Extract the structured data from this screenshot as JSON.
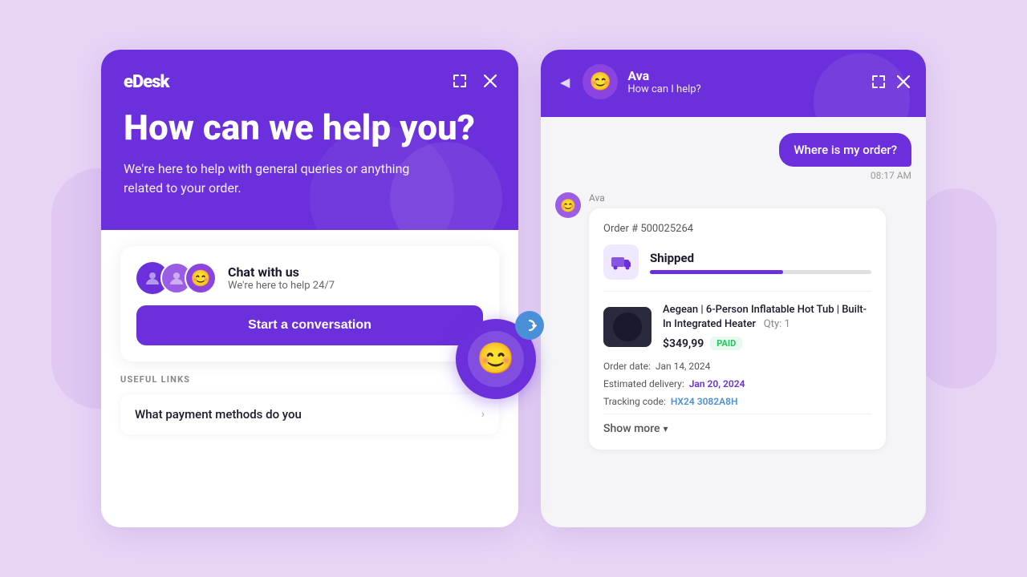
{
  "background": {
    "color": "#e8d5f5"
  },
  "left_panel": {
    "logo": "eDesk",
    "header": {
      "headline": "How can we help you?",
      "subtitle": "We're here to help with general queries or anything related to your order.",
      "expand_icon": "⤢",
      "close_icon": "✕"
    },
    "chat_card": {
      "title": "Chat with us",
      "subtitle": "We're here to help 24/7",
      "start_button": "Start a conversation"
    },
    "useful_links": {
      "label": "USEFUL LINKS",
      "items": [
        {
          "text": "What payment methods do you"
        }
      ]
    }
  },
  "right_panel": {
    "header": {
      "back_icon": "◀",
      "agent_name": "Ava",
      "agent_question": "How can I help?",
      "expand_icon": "⤢",
      "close_icon": "✕"
    },
    "messages": [
      {
        "type": "user",
        "text": "Where is my order?",
        "time": "08:17 AM"
      },
      {
        "type": "bot",
        "sender": "Ava",
        "order": {
          "number": "Order # 500025264",
          "status": "Shipped",
          "progress_percent": 60,
          "product_name": "Aegean | 6-Person Inflatable Hot Tub | Built-In Integrated Heater",
          "quantity": "Qty: 1",
          "price": "$349,99",
          "payment_status": "PAID",
          "order_date_label": "Order date:",
          "order_date": "Jan 14, 2024",
          "delivery_label": "Estimated delivery:",
          "delivery_date": "Jan 20, 2024",
          "tracking_label": "Tracking code:",
          "tracking_code": "HX24 3082A8H"
        },
        "show_more": "Show more"
      }
    ]
  },
  "floating_bot": {
    "emoji": "😊",
    "arrow": "↻"
  }
}
